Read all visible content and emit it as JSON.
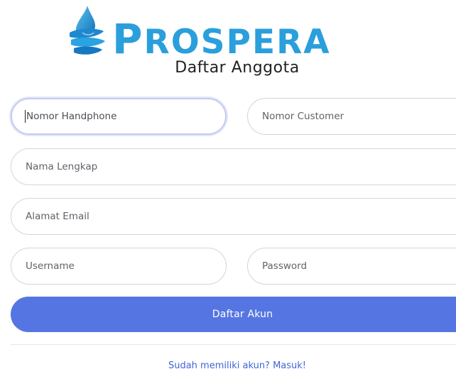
{
  "brand": {
    "logo_icon": "water-drop-swirl-icon",
    "name_cap": "P",
    "name_rest": "ROSPERA",
    "color": "#2a9fdc"
  },
  "page": {
    "title": "Daftar Anggota"
  },
  "form": {
    "phone_placeholder": "Nomor Handphone",
    "customer_placeholder": "Nomor Customer",
    "fullname_placeholder": "Nama Lengkap",
    "email_placeholder": "Alamat Email",
    "username_placeholder": "Username",
    "password_placeholder": "Password",
    "submit_label": "Daftar Akun",
    "submit_color": "#5576e2"
  },
  "footer": {
    "login_link": "Sudah memiliki akun? Masuk!"
  }
}
